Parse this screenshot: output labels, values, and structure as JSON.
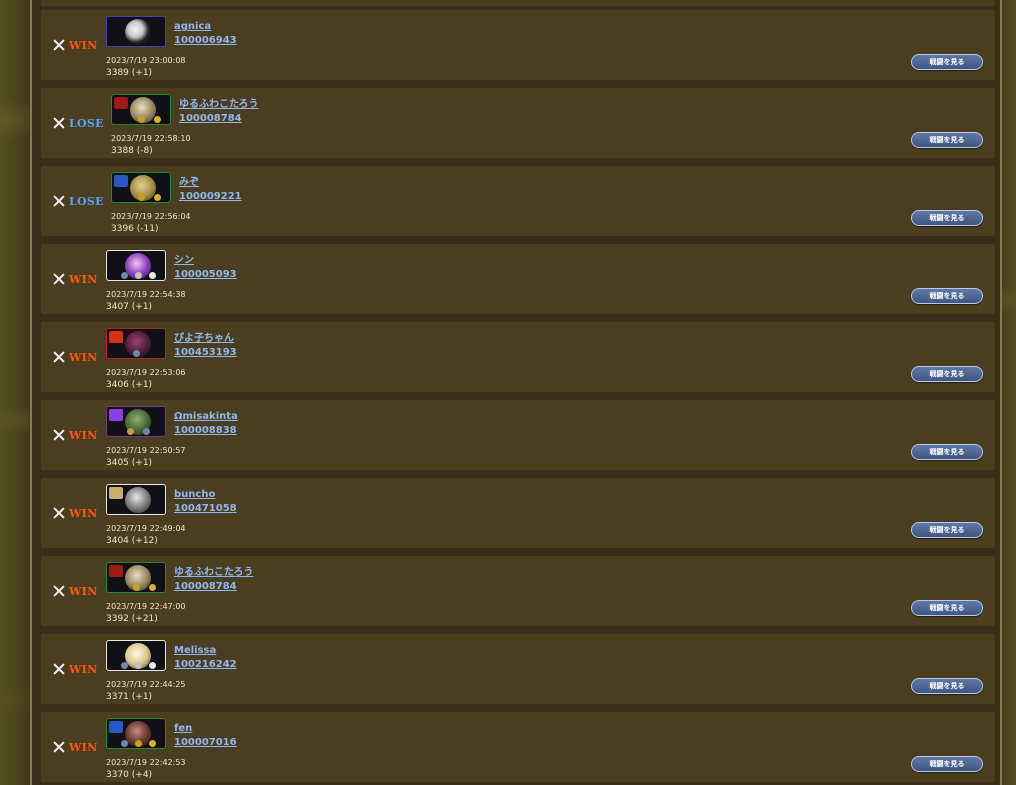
{
  "battle_history": {
    "watch_label": "戦闘を見る",
    "rows": [
      {
        "result": "WIN",
        "name": "agnica",
        "id": "100006943",
        "datetime": "2023/7/19 23:00:08",
        "rating": "3389 (+1)"
      },
      {
        "result": "LOSE",
        "name": "ゆるふわこたろう",
        "id": "100008784",
        "datetime": "2023/7/19 22:58:10",
        "rating": "3388 (-8)"
      },
      {
        "result": "LOSE",
        "name": "みぞ",
        "id": "100009221",
        "datetime": "2023/7/19 22:56:04",
        "rating": "3396 (-11)"
      },
      {
        "result": "WIN",
        "name": "シン",
        "id": "100005093",
        "datetime": "2023/7/19 22:54:38",
        "rating": "3407 (+1)"
      },
      {
        "result": "WIN",
        "name": "ぴよ子ちゃん",
        "id": "100453193",
        "datetime": "2023/7/19 22:53:06",
        "rating": "3406 (+1)"
      },
      {
        "result": "WIN",
        "name": "Ωmisakinta",
        "id": "100008838",
        "datetime": "2023/7/19 22:50:57",
        "rating": "3405 (+1)"
      },
      {
        "result": "WIN",
        "name": "buncho",
        "id": "100471058",
        "datetime": "2023/7/19 22:49:04",
        "rating": "3404 (+12)"
      },
      {
        "result": "WIN",
        "name": "ゆるふわこたろう",
        "id": "100008784",
        "datetime": "2023/7/19 22:47:00",
        "rating": "3392 (+21)"
      },
      {
        "result": "WIN",
        "name": "Melissa",
        "id": "100216242",
        "datetime": "2023/7/19 22:44:25",
        "rating": "3371 (+1)"
      },
      {
        "result": "WIN",
        "name": "fen",
        "id": "100007016",
        "datetime": "2023/7/19 22:42:53",
        "rating": "3370 (+4)"
      }
    ]
  },
  "colors": {
    "win": "#ff5a10",
    "lose": "#5aa4ff",
    "link": "#8fb8f2",
    "row_bg": "#4b3d20"
  },
  "icons": {
    "result": "crossed-swords-icon"
  }
}
